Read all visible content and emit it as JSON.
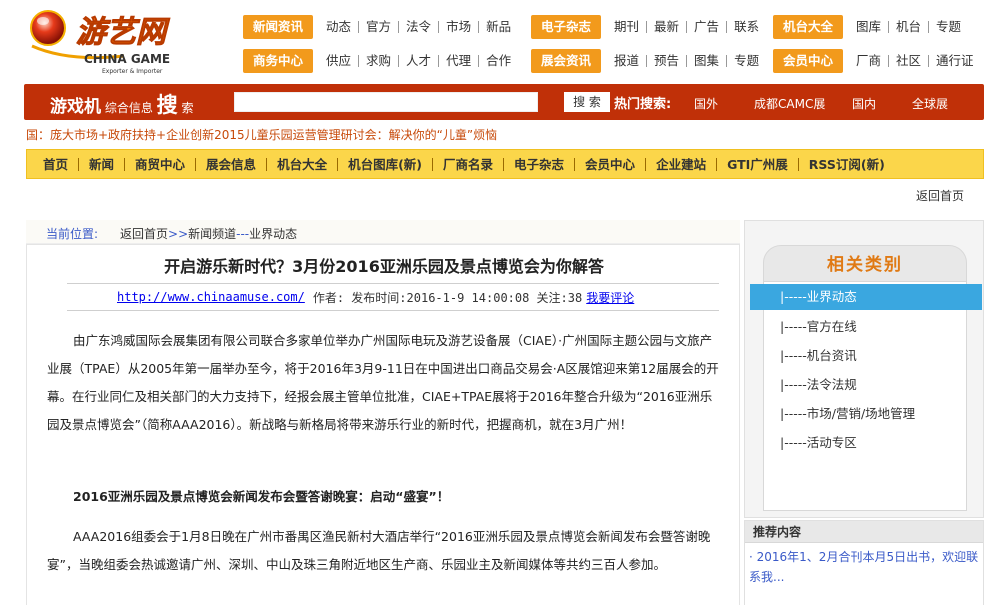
{
  "header": {
    "logo_main": "游艺网",
    "logo_sub": "CHINA GAME",
    "logo_tag": "Exporter & Importer",
    "nav": [
      {
        "category": "新闻资讯",
        "links": [
          "动态",
          "官方",
          "法令",
          "市场",
          "新品"
        ]
      },
      {
        "category": "电子杂志",
        "links": [
          "期刊",
          "最新",
          "广告",
          "联系"
        ]
      },
      {
        "category": "机台大全",
        "links": [
          "图库",
          "机台",
          "专题"
        ]
      },
      {
        "category": "商务中心",
        "links": [
          "供应",
          "求购",
          "人才",
          "代理",
          "合作"
        ]
      },
      {
        "category": "展会资讯",
        "links": [
          "报道",
          "预告",
          "图集",
          "专题"
        ]
      },
      {
        "category": "会员中心",
        "links": [
          "厂商",
          "社区",
          "通行证"
        ]
      }
    ]
  },
  "search": {
    "brand_big1": "游戏机",
    "brand_small1": "综合信息",
    "brand_big2": "搜",
    "brand_small2": "索",
    "input_value": "",
    "button_label": "搜 索",
    "hot_label": "热门搜索:",
    "hot_links": [
      "国外",
      "成都CAMC展",
      "国内",
      "全球展"
    ]
  },
  "ticker": "国：庞大市场+政府扶持+企业创新2015儿童乐园运营管理研讨会：解决你的“儿童”烦恼",
  "main_nav": [
    "首页",
    "新闻",
    "商贸中心",
    "展会信息",
    "机台大全",
    "机台图库(新)",
    "厂商名录",
    "电子杂志",
    "会员中心",
    "企业建站",
    "GTI广州展",
    "RSS订阅(新)"
  ],
  "back_home": "返回首页",
  "breadcrumb": {
    "label": "当前位置:",
    "home": "返回首页",
    "sep1": ">>",
    "channel": "新闻频道",
    "sep2": "---",
    "section": "业界动态"
  },
  "article": {
    "title": "开启游乐新时代？3月份2016亚洲乐园及景点博览会为你解答",
    "url": "http://www.chinaamuse.com/",
    "meta": "作者: 发布时间:2016-1-9 14:00:08 关注:38",
    "comment_link": "我要评论",
    "para1": "由广东鸿威国际会展集团有限公司联合多家单位举办广州国际电玩及游艺设备展（CIAE）·广州国际主题公园与文旅产业展（TPAE）从2005年第一届举办至今，将于2016年3月9-11日在中国进出口商品交易会·A区展馆迎来第12届展会的开幕。在行业同仁及相关部门的大力支持下，经报会展主管单位批准，CIAE+TPAE展将于2016年整合升级为“2016亚洲乐园及景点博览会”（简称AAA2016）。新战略与新格局将带来游乐行业的新时代，把握商机，就在3月广州！",
    "para2": "2016亚洲乐园及景点博览会新闻发布会暨答谢晚宴：启动“盛宴”！",
    "para3": "AAA2016组委会于1月8日晚在广州市番禺区渔民新村大酒店举行“2016亚洲乐园及景点博览会新闻发布会暨答谢晚宴”，当晚组委会热诚邀请广州、深圳、中山及珠三角附近地区生产商、乐园业主及新闻媒体等共约三百人参加。"
  },
  "related": {
    "title": "相关类别",
    "items": [
      "|-----业界动态",
      "|-----官方在线",
      "|-----机台资讯",
      "|-----法令法规",
      "|-----市场/营销/场地管理",
      "|-----活动专区"
    ],
    "active_index": 0
  },
  "recommend": {
    "title": "推荐内容",
    "item": "· 2016年1、2月合刊本月5日出书，欢迎联系我..."
  },
  "colors": {
    "orange": "#f29a1c",
    "red_bar": "#c03008",
    "yellow_nav": "#fbd64a",
    "active_blue": "#3aa7e0",
    "link_blue": "#3a5ac8"
  }
}
